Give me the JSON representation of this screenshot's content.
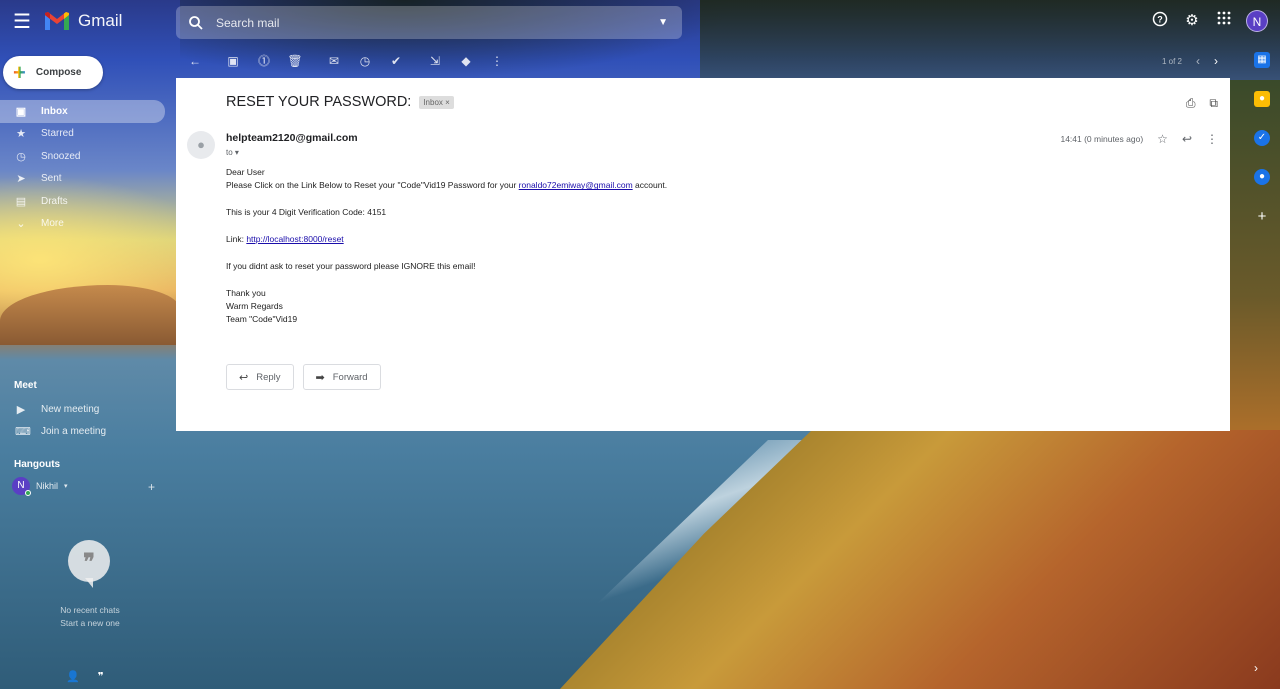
{
  "app": {
    "name": "Gmail",
    "avatar_letter": "N"
  },
  "search": {
    "placeholder": "Search mail"
  },
  "compose": {
    "label": "Compose"
  },
  "nav": {
    "items": [
      {
        "label": "Inbox",
        "icon": "inbox-icon"
      },
      {
        "label": "Starred",
        "icon": "star-icon"
      },
      {
        "label": "Snoozed",
        "icon": "clock-icon"
      },
      {
        "label": "Sent",
        "icon": "send-icon"
      },
      {
        "label": "Drafts",
        "icon": "draft-icon"
      },
      {
        "label": "More",
        "icon": "chevron-down-icon"
      }
    ]
  },
  "meet": {
    "title": "Meet",
    "new_meeting": "New meeting",
    "join_meeting": "Join a meeting"
  },
  "hangouts": {
    "title": "Hangouts",
    "user_name": "Nikhil",
    "user_letter": "N",
    "no_chats_line1": "No recent chats",
    "no_chats_line2": "Start a new one"
  },
  "toolbar": {
    "pager": "1 of 2"
  },
  "message": {
    "subject": "RESET YOUR PASSWORD:",
    "label": "Inbox",
    "sender": "helpteam2120@gmail.com",
    "to": "to",
    "time": "14:41 (0 minutes ago)",
    "greeting": "Dear User",
    "line1_pre": "Please Click on the Link Below to Reset your \"Code\"Vid19 Password for your ",
    "line1_link": "ronaldo72emiway@gmail.com",
    "line1_post": " account.",
    "code_line": "This is your 4 Digit Verification Code: 4151",
    "link_label": "Link: ",
    "link_url": "http://localhost:8000/reset",
    "ignore_line": "If you didnt ask to reset your password please IGNORE this email!",
    "thanks": "Thank you",
    "regards": "Warm Regards",
    "team": "Team \"Code\"Vid19"
  },
  "actions": {
    "reply": "Reply",
    "forward": "Forward"
  }
}
